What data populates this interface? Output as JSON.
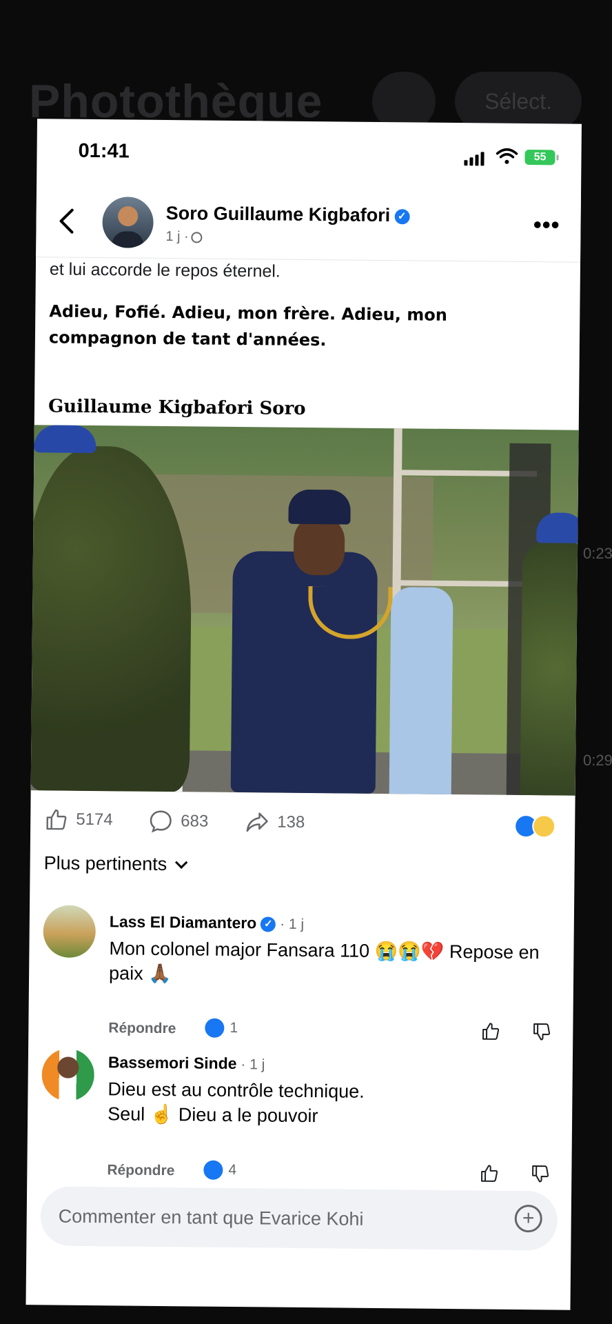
{
  "background_app": {
    "title": "Photothèque",
    "select_label": "Sélect.",
    "thumb_times": [
      "0:23",
      "0:29"
    ]
  },
  "status_bar": {
    "time": "01:41",
    "battery": "55"
  },
  "post": {
    "author": "Soro Guillaume Kigbafori",
    "meta": "1 j ·",
    "text_tail": "et lui accorde le repos éternel.",
    "farewell": "Adieu, Fofié. Adieu, mon frère. Adieu, mon compagnon de tant d'années.",
    "signature": "Guillaume Kigbafori Soro",
    "likes": "5174",
    "comments": "683",
    "shares": "138"
  },
  "sort_label": "Plus pertinents",
  "comments": [
    {
      "name": "Lass El Diamantero",
      "time": " · 1 j",
      "text": "Mon colonel major Fansara 110 😭😭💔 Repose en paix 🙏🏾",
      "reply": "Répondre",
      "likes": "1"
    },
    {
      "name": "Bassemori Sinde",
      "time": " · 1 j",
      "text_line1": "Dieu est au contrôle technique.",
      "text_line2": "Seul ☝️ Dieu a le pouvoir",
      "reply": "Répondre",
      "likes": "4"
    }
  ],
  "composer": {
    "placeholder": "Commenter en tant que Evarice Kohi"
  },
  "colors": {
    "facebook_blue": "#1877f2",
    "battery_green": "#34c759",
    "secondary_text": "#65676b"
  }
}
